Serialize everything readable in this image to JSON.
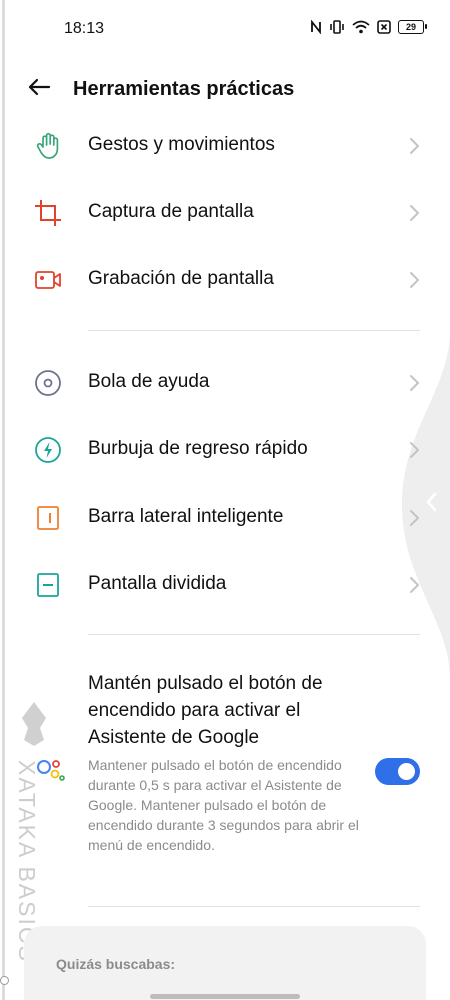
{
  "status_bar": {
    "time": "18:13",
    "battery_level": "29",
    "icons": [
      "nfc-icon",
      "vibrate-icon",
      "wifi-icon",
      "sim-off-icon",
      "battery-icon"
    ]
  },
  "header": {
    "title": "Herramientas prácticas",
    "back_icon": "arrow-left-icon"
  },
  "groups": [
    {
      "items": [
        {
          "label": "Gestos y movimientos",
          "icon": "hand-gesture-icon",
          "color": "#3aa57a"
        },
        {
          "label": "Captura de pantalla",
          "icon": "crop-icon",
          "color": "#e0442c"
        },
        {
          "label": "Grabación de pantalla",
          "icon": "video-record-icon",
          "color": "#e0442c"
        }
      ]
    },
    {
      "items": [
        {
          "label": "Bola de ayuda",
          "icon": "assist-ball-icon",
          "color": "#6b7290"
        },
        {
          "label": "Burbuja de regreso rápido",
          "icon": "bolt-bubble-icon",
          "color": "#1aa598"
        },
        {
          "label": "Barra lateral inteligente",
          "icon": "side-bar-icon",
          "color": "#ef7f36"
        },
        {
          "label": "Pantalla dividida",
          "icon": "split-screen-icon",
          "color": "#1aa598"
        }
      ]
    }
  ],
  "assistant_setting": {
    "title": "Mantén pulsado el botón de encendido para activar el Asistente de Google",
    "description": "Mantener pulsado el botón de encendido durante 0,5 s para activar el Asistente de Google. Mantener pulsado el botón de encendido durante 3 segundos para abrir el menú de encendido.",
    "enabled": true,
    "toggle_color": "#2f6fe8"
  },
  "suggestions": {
    "label": "Quizás buscabas:"
  },
  "watermark": {
    "text": "XATAKA BASICS"
  }
}
